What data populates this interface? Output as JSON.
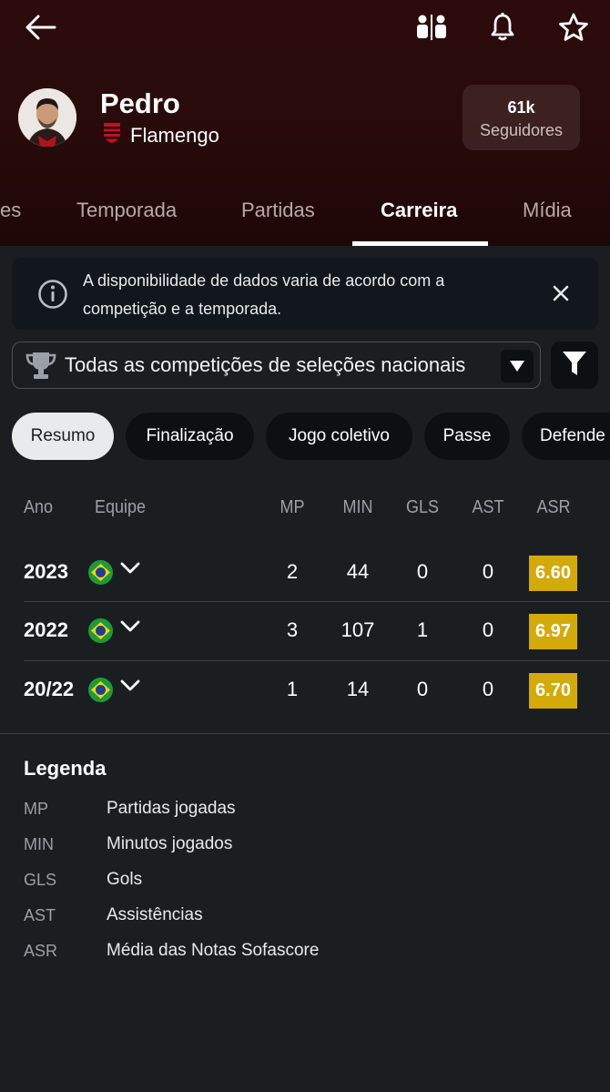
{
  "player": {
    "name": "Pedro",
    "club": "Flamengo",
    "followers_count": "61k",
    "followers_label": "Seguidores"
  },
  "tabs": [
    {
      "label": "es",
      "active": false
    },
    {
      "label": "Temporada",
      "active": false
    },
    {
      "label": "Partidas",
      "active": false
    },
    {
      "label": "Carreira",
      "active": true
    },
    {
      "label": "Mídia",
      "active": false
    }
  ],
  "notice": {
    "text": "A disponibilidade de dados varia de acordo com a competição e a temporada."
  },
  "competition_select": {
    "selected": "Todas as competições de seleções nacionais"
  },
  "chips": [
    {
      "label": "Resumo",
      "active": true
    },
    {
      "label": "Finalização",
      "active": false
    },
    {
      "label": "Jogo coletivo",
      "active": false
    },
    {
      "label": "Passe",
      "active": false
    },
    {
      "label": "Defende",
      "active": false
    }
  ],
  "table": {
    "headers": {
      "year": "Ano",
      "team": "Equipe",
      "mp": "MP",
      "min": "MIN",
      "gls": "GLS",
      "ast": "AST",
      "asr": "ASR"
    },
    "rows": [
      {
        "year": "2023",
        "mp": "2",
        "min": "44",
        "gls": "0",
        "ast": "0",
        "asr": "6.60"
      },
      {
        "year": "2022",
        "mp": "3",
        "min": "107",
        "gls": "1",
        "ast": "0",
        "asr": "6.97"
      },
      {
        "year": "20/22",
        "mp": "1",
        "min": "14",
        "gls": "0",
        "ast": "0",
        "asr": "6.70"
      }
    ]
  },
  "legend": {
    "title": "Legenda",
    "items": [
      {
        "abbr": "MP",
        "desc": "Partidas jogadas"
      },
      {
        "abbr": "MIN",
        "desc": "Minutos jogados"
      },
      {
        "abbr": "GLS",
        "desc": "Gols"
      },
      {
        "abbr": "AST",
        "desc": "Assistências"
      },
      {
        "abbr": "ASR",
        "desc": "Média das Notas Sofascore"
      }
    ]
  },
  "colors": {
    "header_bg": "#2a0b0b",
    "page_bg": "#1b1e21",
    "rating_bg": "#d4a90a"
  },
  "icons": [
    "back-arrow-icon",
    "compare-players-icon",
    "bell-icon",
    "star-icon",
    "info-icon",
    "close-icon",
    "trophy-icon",
    "caret-down-icon",
    "filter-icon",
    "brazil-flag-icon",
    "chevron-down-icon"
  ]
}
